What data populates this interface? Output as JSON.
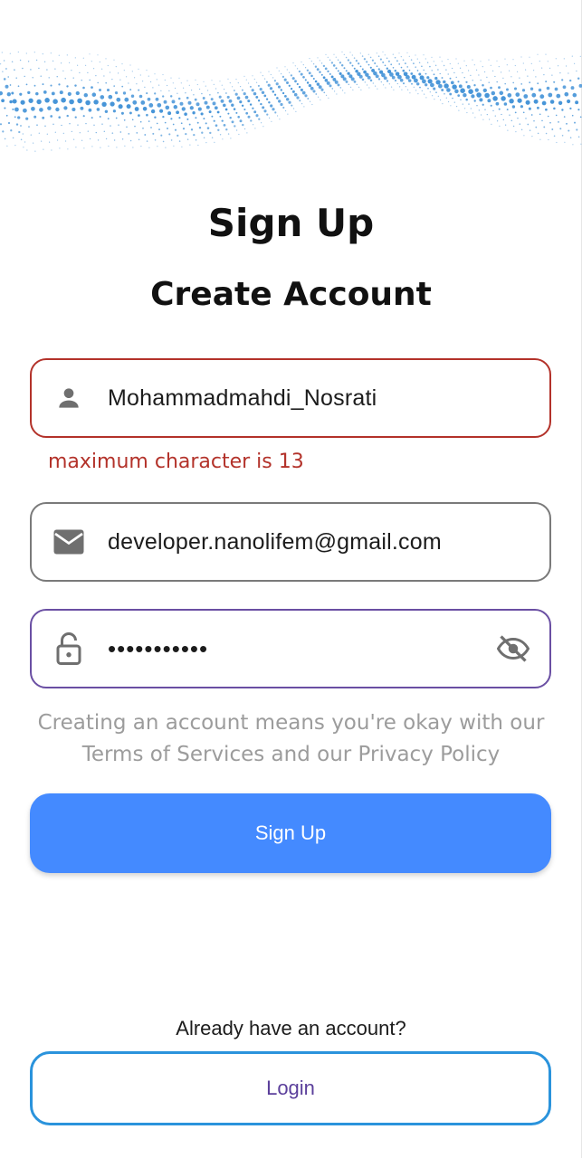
{
  "header": {
    "title": "Sign Up",
    "subtitle": "Create Account"
  },
  "form": {
    "username": {
      "icon": "person-icon",
      "value": "Mohammadmahdi_Nosrati",
      "error": "maximum character is 13"
    },
    "email": {
      "icon": "mail-icon",
      "value": "developer.nanolifem@gmail.com"
    },
    "password": {
      "icon": "lock-icon",
      "value": "•••••••••••",
      "toggle_icon": "eye-off-icon"
    }
  },
  "terms": {
    "line1": "Creating an account means you're okay with our",
    "line2": "Terms of Services and our Privacy Policy"
  },
  "actions": {
    "signup_label": "Sign Up",
    "already_text": "Already have an account?",
    "login_label": "Login"
  },
  "colors": {
    "primary": "#448aff",
    "error": "#b3322a",
    "focus": "#6a4fa3",
    "login_border": "#2a93dc",
    "login_text": "#5b3f9b",
    "wave": "#3d8fd6"
  }
}
